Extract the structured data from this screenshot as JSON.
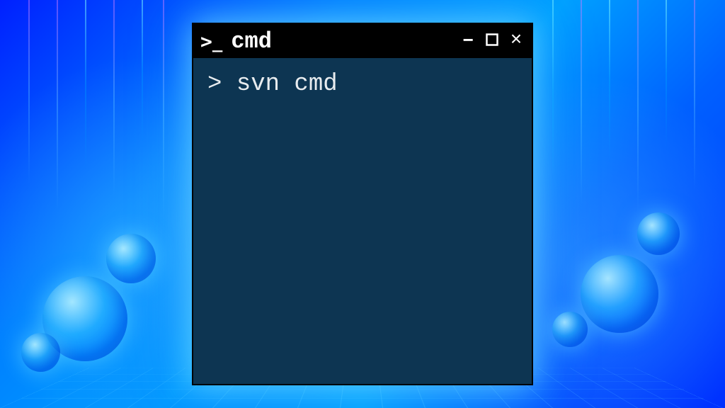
{
  "window": {
    "title": "cmd",
    "icon_prompt": ">",
    "icon_underscore": "_"
  },
  "controls": {
    "minimize": "−",
    "close": "×"
  },
  "terminal": {
    "prompt": ">",
    "command": "svn cmd"
  },
  "colors": {
    "titlebar_bg": "#000000",
    "body_bg": "#0d3552",
    "text": "#e8ecef",
    "glow": "#78e6ff"
  }
}
